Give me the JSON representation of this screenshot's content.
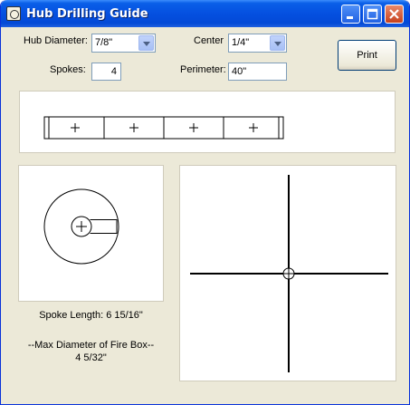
{
  "window": {
    "title": "Hub Drilling Guide"
  },
  "form": {
    "hub_diameter_label": "Hub Diameter:",
    "hub_diameter_value": "7/8\"",
    "center_label": "Center",
    "center_value": "1/4\"",
    "spokes_label": "Spokes:",
    "spokes_value": "4",
    "perimeter_label": "Perimeter:",
    "perimeter_value": "40\""
  },
  "buttons": {
    "print_label": "Print"
  },
  "results": {
    "spoke_length": "Spoke Length: 6 15/16\"",
    "max_diameter_label": "--Max Diameter of Fire Box--",
    "max_diameter_value": "4 5/32\""
  },
  "colors": {
    "titlebar": "#0550e0",
    "face": "#ece9d8",
    "close": "#c7401c"
  }
}
